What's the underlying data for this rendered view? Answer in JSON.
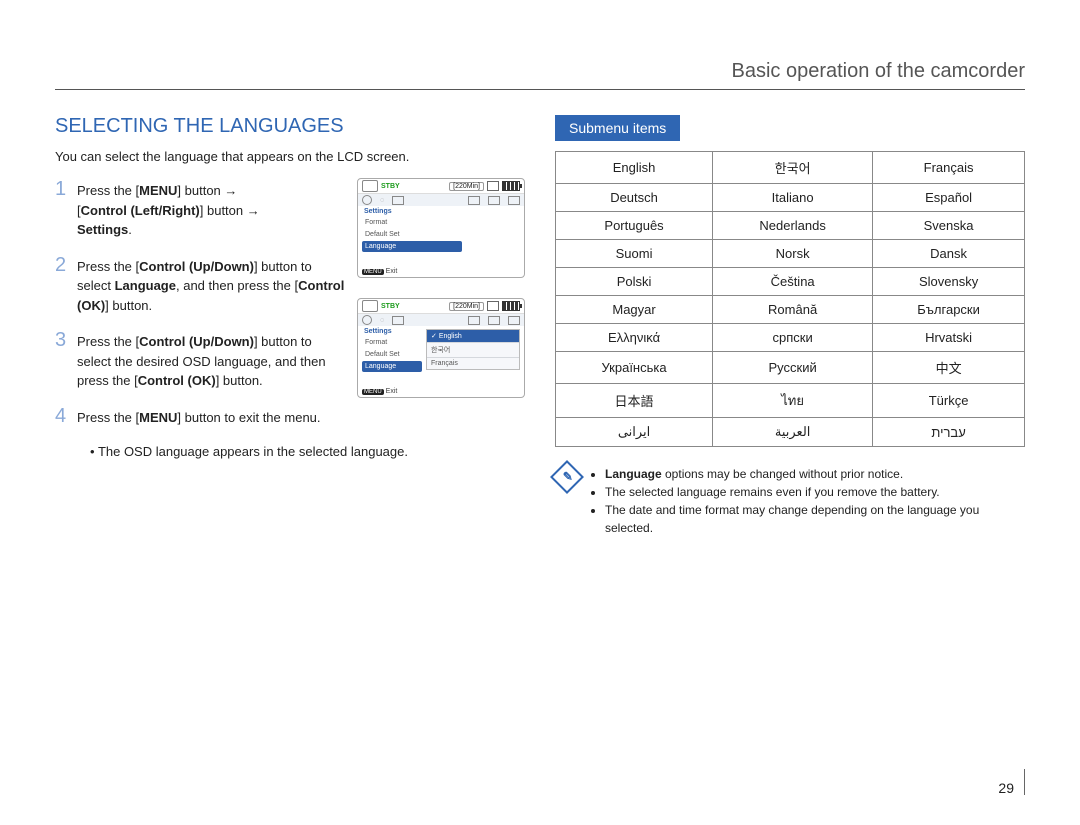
{
  "header": "Basic operation of the camcorder",
  "section_title": "SELECTING THE LANGUAGES",
  "intro": "You can select the language that appears on the LCD screen.",
  "steps": {
    "n1": "1",
    "s1_a": "Press the [",
    "s1_menu": "MENU",
    "s1_b": "] button ",
    "s1_arrow": "→",
    "s1_c": " [",
    "s1_ctrl": "Control (Left/Right)",
    "s1_d": "] button ",
    "s1_e": " ",
    "s1_settings": "Settings",
    "s1_f": ".",
    "n2": "2",
    "s2_a": "Press the [",
    "s2_ctrl": "Control (Up/Down)",
    "s2_b": "] button to select ",
    "s2_lang": "Language",
    "s2_c": ", and then press the [",
    "s2_ok": "Control (OK)",
    "s2_d": "] button.",
    "n3": "3",
    "s3_a": "Press the [",
    "s3_ctrl": "Control (Up/Down)",
    "s3_b": "] button to select the desired OSD language, and then press the [",
    "s3_ok": "Control (OK)",
    "s3_c": "] button.",
    "n4": "4",
    "s4_a": "Press the [",
    "s4_menu": "MENU",
    "s4_b": "] button to exit the menu.",
    "s4_bullet": "The OSD language appears in the selected language."
  },
  "screen": {
    "stby": "STBY",
    "time": "[220Min]",
    "settings": "Settings",
    "format": "Format",
    "default_set": "Default Set",
    "language": "Language",
    "exit": "Exit",
    "menu_btn": "MENU",
    "opt_en": "English",
    "opt_ko": "한국어",
    "opt_fr": "Français"
  },
  "submenu_label": "Submenu items",
  "langs": [
    [
      "English",
      "한국어",
      "Français"
    ],
    [
      "Deutsch",
      "Italiano",
      "Español"
    ],
    [
      "Português",
      "Nederlands",
      "Svenska"
    ],
    [
      "Suomi",
      "Norsk",
      "Dansk"
    ],
    [
      "Polski",
      "Čeština",
      "Slovensky"
    ],
    [
      "Magyar",
      "Română",
      "Български"
    ],
    [
      "Ελληνικά",
      "српски",
      "Hrvatski"
    ],
    [
      "Українська",
      "Русский",
      "中文"
    ],
    [
      "日本語",
      "ไทย",
      "Türkçe"
    ],
    [
      "ایرانی",
      "العربية",
      "עברית"
    ]
  ],
  "notes": {
    "n1a": "Language",
    "n1b": " options may be changed without prior notice.",
    "n2": "The selected language remains even if you remove the battery.",
    "n3": "The date and time format may change depending on the language you selected."
  },
  "page_number": "29"
}
